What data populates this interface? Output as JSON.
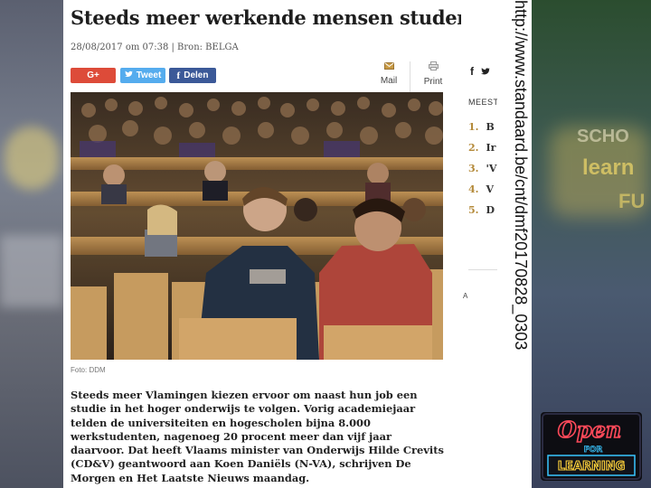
{
  "article": {
    "title": "Steeds meer werkende mensen studeren",
    "meta": "28/08/2017 om 07:38 | Bron: BELGA",
    "share": {
      "gplus_label": "G+",
      "tweet_label": "Tweet",
      "facebook_label": "Delen"
    },
    "tools": {
      "mail_label": "Mail",
      "print_label": "Print"
    },
    "photo_caption": "Foto: DDM",
    "lead": "Steeds meer Vlamingen kiezen ervoor om naast hun job een studie in het hoger onderwijs te volgen. Vorig academiejaar telden de universiteiten en hogescholen bijna 8.000 werkstudenten, nagenoeg 20 procent meer dan vijf jaar daarvoor. Dat heeft Vlaams minister van Onderwijs Hilde Crevits (CD&V) geantwoord aan Koen Daniëls (N-VA), schrijven De Morgen en Het Laatste Nieuws maandag."
  },
  "sidebar": {
    "heading": "MEEST",
    "items": [
      {
        "num": "1.",
        "text": "B"
      },
      {
        "num": "2.",
        "text": "Ir"
      },
      {
        "num": "3.",
        "text": "'V"
      },
      {
        "num": "4.",
        "text": "V"
      },
      {
        "num": "5.",
        "text": "D"
      }
    ],
    "ad_label": "A"
  },
  "source_url": "http://www.standaard.be/cnt/dmf20170828_0303",
  "logo": {
    "line1": "Open",
    "line2": "FOR",
    "line3": "LEARNING"
  },
  "background": {
    "school_text": "SCHO",
    "learn_text": "learn",
    "fu_text": "FU"
  },
  "colors": {
    "gplus": "#dd4b39",
    "twitter": "#55acee",
    "facebook": "#3b5998",
    "accent": "#b48a3a",
    "neon_red": "#ff4a5a",
    "neon_blue": "#39c6ff",
    "neon_yellow": "#ffd23a"
  }
}
